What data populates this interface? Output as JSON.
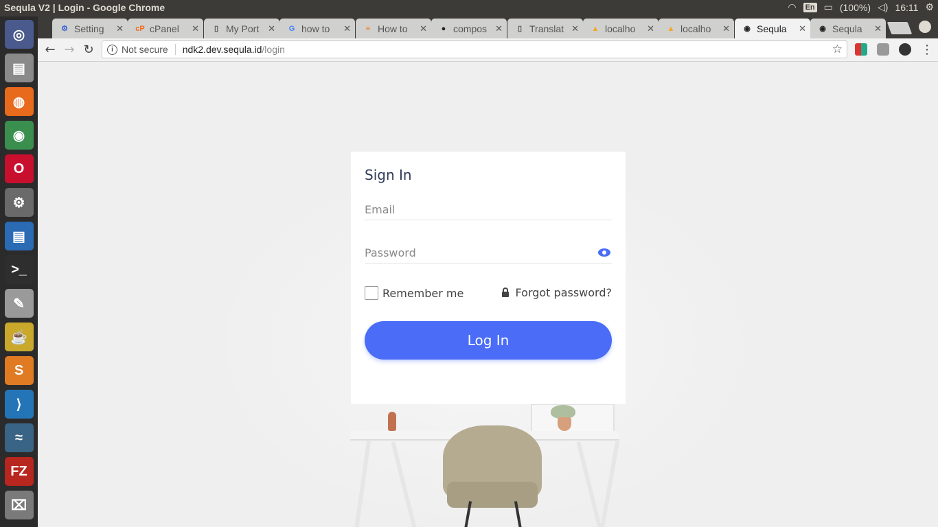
{
  "window": {
    "title": "Sequla V2 | Login - Google Chrome"
  },
  "tray": {
    "lang": "En",
    "battery": "(100%)",
    "time": "16:11"
  },
  "tabs": [
    {
      "label": "Setting",
      "icon": "gear-icon",
      "fav": "⚙",
      "color": "#3a63d6"
    },
    {
      "label": "cPanel",
      "icon": "cpanel-icon",
      "fav": "cP",
      "color": "#f06a1a"
    },
    {
      "label": "My Port",
      "icon": "document-icon",
      "fav": "▯",
      "color": "#555555"
    },
    {
      "label": "how to",
      "icon": "google-icon",
      "fav": "G",
      "color": "#4285f4"
    },
    {
      "label": "How to",
      "icon": "stackoverflow-icon",
      "fav": "≡",
      "color": "#f48024"
    },
    {
      "label": "compos",
      "icon": "github-icon",
      "fav": "●",
      "color": "#222222"
    },
    {
      "label": "Translat",
      "icon": "document-icon",
      "fav": "▯",
      "color": "#555555"
    },
    {
      "label": "localho",
      "icon": "phpmyadmin-icon",
      "fav": "▲",
      "color": "#f5a623"
    },
    {
      "label": "localho",
      "icon": "phpmyadmin-icon",
      "fav": "▲",
      "color": "#f5a623"
    },
    {
      "label": "Sequla",
      "icon": "sequla-icon",
      "fav": "◉",
      "color": "#222222",
      "active": true
    },
    {
      "label": "Sequla",
      "icon": "sequla-icon",
      "fav": "◉",
      "color": "#222222"
    }
  ],
  "toolbar": {
    "security": "Not secure",
    "url_host": "ndk2.dev.sequla.id",
    "url_path": "/login"
  },
  "login": {
    "heading": "Sign In",
    "email_placeholder": "Email",
    "password_placeholder": "Password",
    "remember_label": "Remember me",
    "forgot_label": "Forgot password?",
    "button_label": "Log In",
    "accent": "#4a6cf7"
  },
  "launcher": [
    {
      "name": "ubuntu-dash-icon",
      "color": "#4a5a8c",
      "glyph": "◎"
    },
    {
      "name": "files-icon",
      "color": "#8a8a8a",
      "glyph": "▤"
    },
    {
      "name": "firefox-icon",
      "color": "#e86a1c",
      "glyph": "◍"
    },
    {
      "name": "chrome-icon",
      "color": "#3a8f4f",
      "glyph": "◉"
    },
    {
      "name": "opera-icon",
      "color": "#c8102e",
      "glyph": "O"
    },
    {
      "name": "settings-icon",
      "color": "#6a6a6a",
      "glyph": "⚙"
    },
    {
      "name": "writer-icon",
      "color": "#2a6bb3",
      "glyph": "▤"
    },
    {
      "name": "terminal-icon",
      "color": "#2e2e2e",
      "glyph": ">_"
    },
    {
      "name": "text-editor-icon",
      "color": "#9a9a9a",
      "glyph": "✎"
    },
    {
      "name": "teapot-icon",
      "color": "#c9a82c",
      "glyph": "☕"
    },
    {
      "name": "sublime-icon",
      "color": "#e07b24",
      "glyph": "S"
    },
    {
      "name": "vscode-icon",
      "color": "#2475b8",
      "glyph": "⟩"
    },
    {
      "name": "mysql-workbench-icon",
      "color": "#3a6486",
      "glyph": "≈"
    },
    {
      "name": "filezilla-icon",
      "color": "#b7261f",
      "glyph": "FZ"
    },
    {
      "name": "trash-icon",
      "color": "#7a7a7a",
      "glyph": "⌧"
    }
  ]
}
